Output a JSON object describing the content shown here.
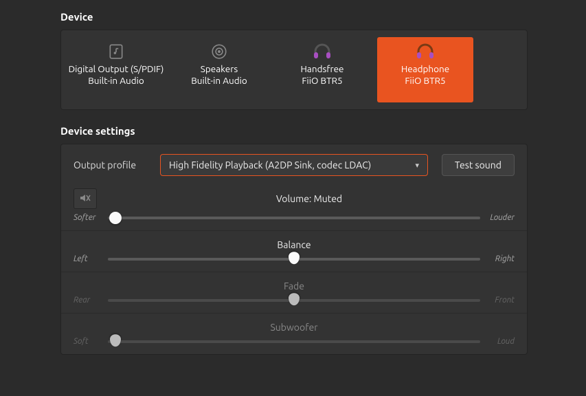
{
  "sections": {
    "device_title": "Device",
    "settings_title": "Device settings"
  },
  "devices": [
    {
      "line1": "Digital Output (S/PDIF)",
      "line2": "Built-in Audio",
      "icon": "digital",
      "selected": false
    },
    {
      "line1": "Speakers",
      "line2": "Built-in Audio",
      "icon": "speaker",
      "selected": false
    },
    {
      "line1": "Handsfree",
      "line2": "FiiO BTR5",
      "icon": "headset",
      "selected": false
    },
    {
      "line1": "Headphone",
      "line2": "FiiO BTR5",
      "icon": "headset",
      "selected": true
    }
  ],
  "settings": {
    "output_profile_label": "Output profile",
    "output_profile_value": "High Fidelity Playback (A2DP Sink, codec LDAC)",
    "test_button": "Test sound",
    "volume": {
      "status": "Volume: Muted",
      "left_label": "Softer",
      "right_label": "Louder",
      "percent": 2
    },
    "balance": {
      "title": "Balance",
      "left_label": "Left",
      "right_label": "Right",
      "percent": 50
    },
    "fade": {
      "title": "Fade",
      "left_label": "Rear",
      "right_label": "Front",
      "percent": 50,
      "disabled": true
    },
    "subwoofer": {
      "title": "Subwoofer",
      "left_label": "Soft",
      "right_label": "Loud",
      "percent": 2,
      "disabled": true
    }
  },
  "colors": {
    "accent": "#e95420",
    "headset_icon": "#a84fc1"
  }
}
